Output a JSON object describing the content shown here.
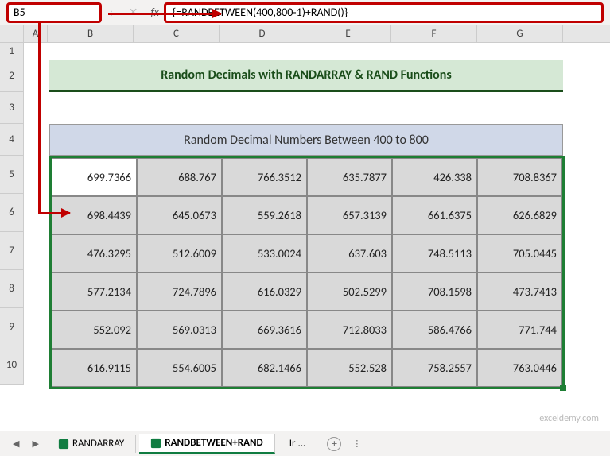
{
  "nameBox": "B5",
  "formula": "{=RANDBETWEEN(400,800-1)+RAND()}",
  "columns": [
    "A",
    "B",
    "C",
    "D",
    "E",
    "F",
    "G"
  ],
  "rows": [
    "1",
    "2",
    "3",
    "4",
    "5",
    "6",
    "7",
    "8",
    "9",
    "10"
  ],
  "title": "Random Decimals with RANDARRAY & RAND Functions",
  "subtitle": "Random Decimal Numbers Between 400 to 800",
  "chart_data": {
    "type": "table",
    "title": "Random Decimal Numbers Between 400 to 800",
    "columns": [
      "B",
      "C",
      "D",
      "E",
      "F",
      "G"
    ],
    "rows": [
      [
        699.7366,
        688.767,
        766.3512,
        635.7877,
        426.338,
        708.8367
      ],
      [
        698.4439,
        645.0673,
        559.2618,
        657.3139,
        661.6375,
        626.6829
      ],
      [
        476.3295,
        512.6009,
        533.0024,
        637.603,
        748.5113,
        705.0445
      ],
      [
        577.2134,
        724.7896,
        616.0329,
        502.5299,
        708.1598,
        473.7413
      ],
      [
        552.092,
        569.0313,
        669.3616,
        712.8033,
        586.4766,
        771.744
      ],
      [
        616.9115,
        554.6005,
        682.1466,
        552.528,
        758.2557,
        763.0446
      ]
    ]
  },
  "tabs": {
    "prev": "RANDARRAY",
    "active": "RANDBETWEEN+RAND",
    "next": "Ir ..."
  },
  "watermark": "exceldemy.com"
}
